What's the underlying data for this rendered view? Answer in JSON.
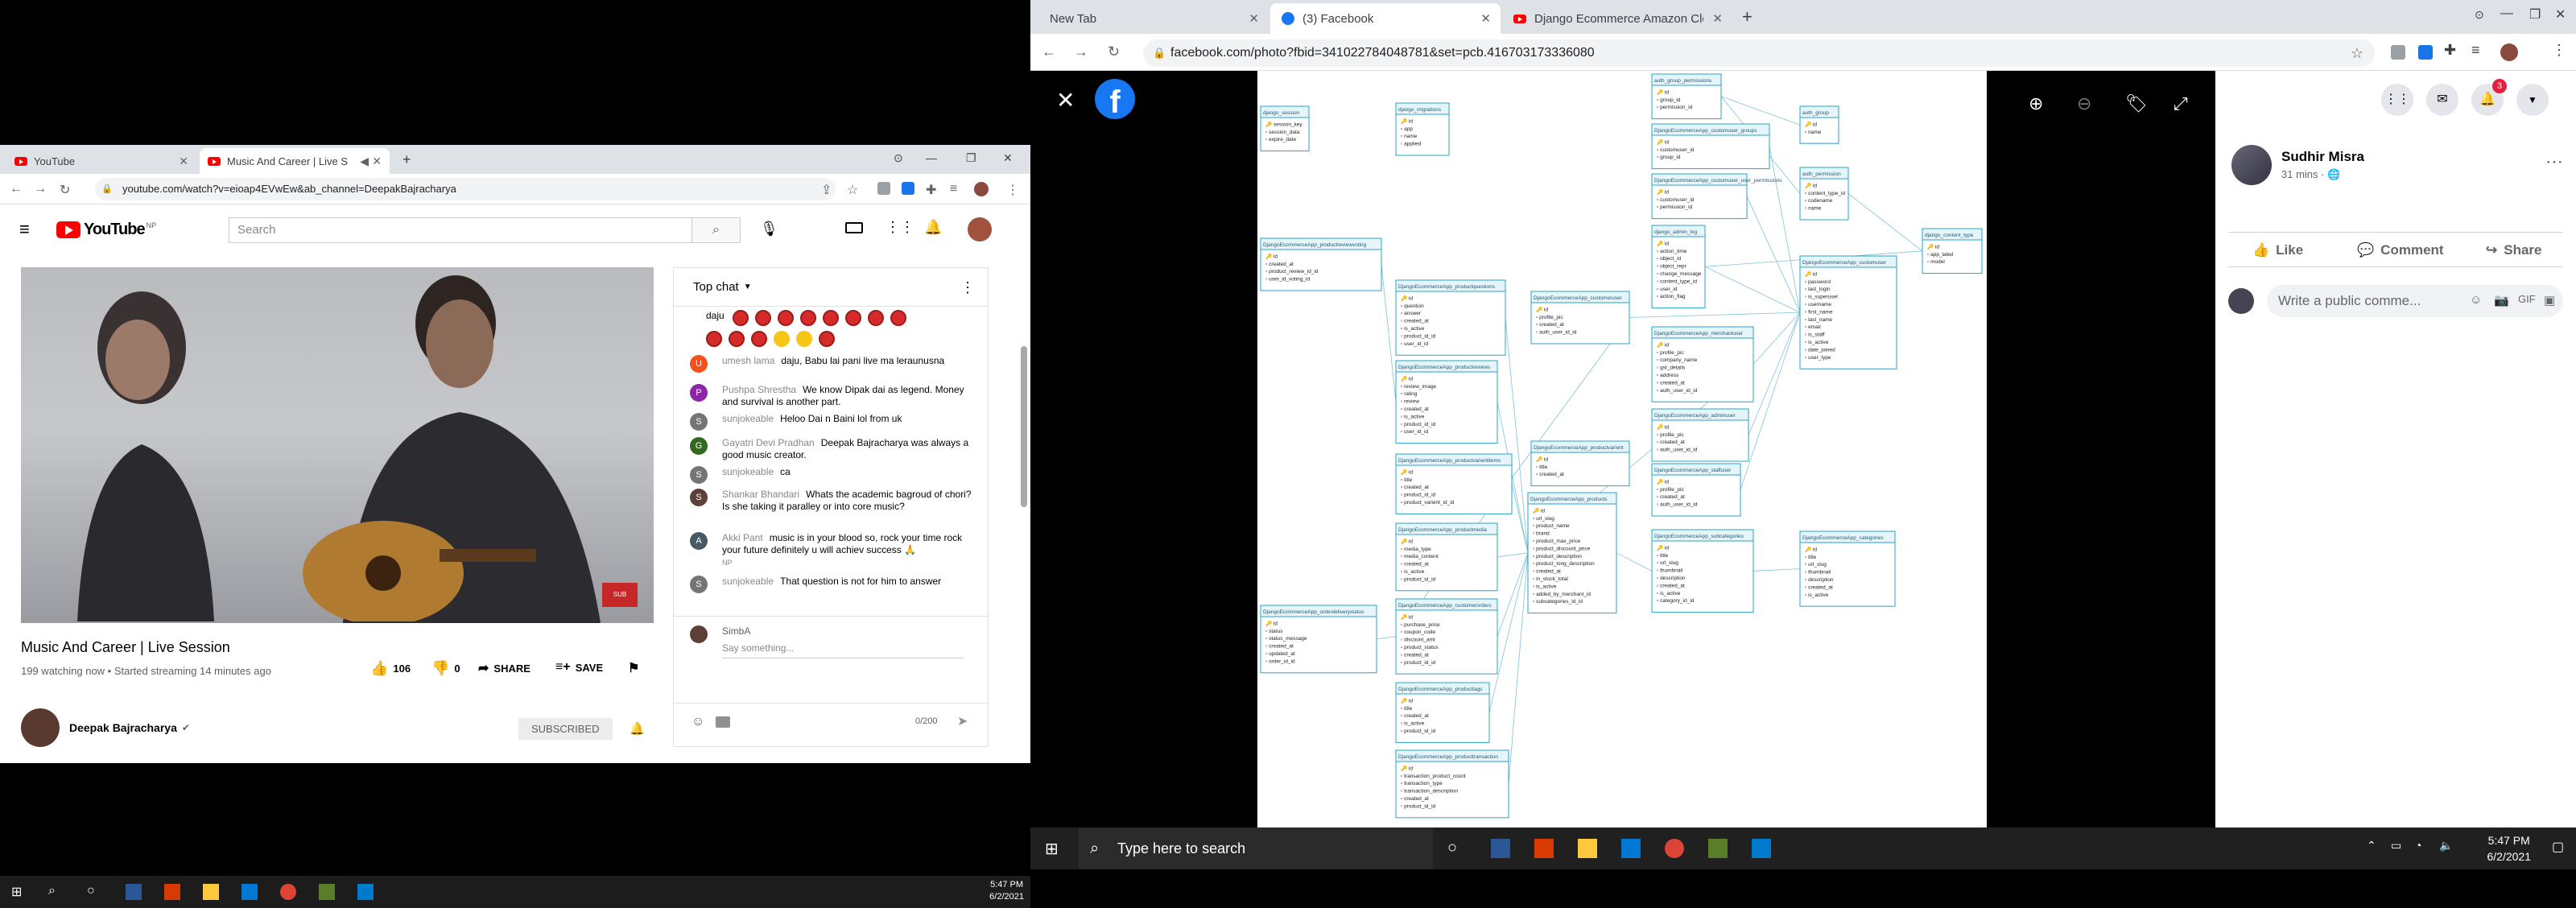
{
  "left_window": {
    "tabs": [
      {
        "title": "YouTube"
      },
      {
        "title": "Music And Career | Live Sess"
      }
    ],
    "url": "youtube.com/watch?v=eioap4EVwEw&ab_channel=DeepakBajracharya",
    "youtube": {
      "logo_text": "YouTube",
      "logo_region": "NP",
      "search_placeholder": "Search"
    },
    "video": {
      "title": "Music And Career | Live Session",
      "meta": "199 watching now • Started streaming 14 minutes ago",
      "likes": "106",
      "dislikes": "0",
      "share_label": "SHARE",
      "save_label": "SAVE",
      "channel_name": "Deepak Bajracharya",
      "subscribe_label": "SUBSCRIBED"
    },
    "chat": {
      "header": "Top chat",
      "first_line": "daju",
      "messages": [
        {
          "author": "umesh lama",
          "text": "daju, Babu lai pani live ma leraunusna",
          "avatar_letter": "U",
          "color": "#f4511e"
        },
        {
          "author": "Pushpa Shrestha",
          "text": "We know Dipak dai as legend. Money and survival is another part.",
          "avatar_letter": "P",
          "color": "#8e24aa"
        },
        {
          "author": "sunjokeable",
          "text": "Heloo Dai n Baini lol from uk",
          "avatar_letter": "S",
          "color": "#757575"
        },
        {
          "author": "Gayatri Devi Pradhan",
          "text": "Deepak Bajracharya was always a good music creator.",
          "avatar_letter": "G",
          "color": "#33691e"
        },
        {
          "author": "sunjokeable",
          "text": "ca",
          "avatar_letter": "S",
          "color": "#757575"
        },
        {
          "author": "Shankar Bhandari",
          "text": "Whats the academic bagroud of chori? Is she taking it paralley or into core music?",
          "avatar_letter": "S",
          "color": "#5d4037"
        },
        {
          "author": "Akki Pant",
          "text": "music is in your blood so, rock your time rock your future definitely u will achiev success 🙏",
          "avatar_letter": "A",
          "color": "#455a64"
        },
        {
          "author": "sunjokeable",
          "text": "That question is not for him to answer",
          "avatar_letter": "S",
          "color": "#757575"
        }
      ],
      "np_tag": "NP",
      "input_user": "SimbA",
      "input_placeholder": "Say something...",
      "char_count": "0/200"
    },
    "taskbar_time": "5:47 PM",
    "taskbar_date": "6/2/2021"
  },
  "right_window": {
    "tabs": [
      {
        "title": "New Tab"
      },
      {
        "title": "(3) Facebook"
      },
      {
        "title": "Django Ecommerce Amazon Clo"
      }
    ],
    "url": "facebook.com/photo?fbid=341022784048781&set=pcb.416703173336080",
    "post": {
      "author": "Sudhir Misra",
      "time": "31 mins · ",
      "like_label": "Like",
      "comment_label": "Comment",
      "share_label": "Share",
      "comment_placeholder": "Write a public comme..."
    },
    "notification_count": "3",
    "taskbar": {
      "search_placeholder": "Type here to search",
      "time": "5:47 PM",
      "date": "6/2/2021"
    }
  },
  "diagram_tables": [
    {
      "name": "django_session",
      "fields": [
        "session_key",
        "session_data",
        "expire_date"
      ]
    },
    {
      "name": "django_migrations",
      "fields": [
        "id",
        "app",
        "name",
        "applied"
      ]
    },
    {
      "name": "auth_group_permissions",
      "fields": [
        "id",
        "group_id",
        "permission_id"
      ]
    },
    {
      "name": "auth_group",
      "fields": [
        "id",
        "name"
      ]
    },
    {
      "name": "DjangoEcommerceApp_customuser_groups",
      "fields": [
        "id",
        "customuser_id",
        "group_id"
      ]
    },
    {
      "name": "auth_permission",
      "fields": [
        "id",
        "content_type_id",
        "codename",
        "name"
      ]
    },
    {
      "name": "DjangoEcommerceApp_customuser_user_permissions",
      "fields": [
        "id",
        "customuser_id",
        "permission_id"
      ]
    },
    {
      "name": "django_content_type",
      "fields": [
        "id",
        "app_label",
        "model"
      ]
    },
    {
      "name": "DjangoEcommerceApp_productreviewvoting",
      "fields": [
        "id",
        "created_at",
        "product_review_id_id",
        "user_id_voting_id"
      ]
    },
    {
      "name": "django_admin_log",
      "fields": [
        "id",
        "action_time",
        "object_id",
        "object_repr",
        "change_message",
        "content_type_id",
        "user_id",
        "action_flag"
      ]
    },
    {
      "name": "DjangoEcommerceApp_customuser",
      "fields": [
        "id",
        "password",
        "last_login",
        "is_superuser",
        "username",
        "first_name",
        "last_name",
        "email",
        "is_staff",
        "is_active",
        "date_joined",
        "user_type"
      ]
    },
    {
      "name": "DjangoEcommerceApp_productquestions",
      "fields": [
        "id",
        "question",
        "answer",
        "created_at",
        "is_active",
        "product_id_id",
        "user_id_id"
      ]
    },
    {
      "name": "DjangoEcommerceApp_customeruser",
      "fields": [
        "id",
        "profile_pic",
        "created_at",
        "auth_user_id_id"
      ]
    },
    {
      "name": "DjangoEcommerceApp_merchantuser",
      "fields": [
        "id",
        "profile_pic",
        "company_name",
        "gst_details",
        "address",
        "created_at",
        "auth_user_id_id"
      ]
    },
    {
      "name": "DjangoEcommerceApp_productreviews",
      "fields": [
        "id",
        "review_image",
        "rating",
        "review",
        "created_at",
        "is_active",
        "product_id_id",
        "user_id_id"
      ]
    },
    {
      "name": "DjangoEcommerceApp_adminuser",
      "fields": [
        "id",
        "profile_pic",
        "created_at",
        "auth_user_id_id"
      ]
    },
    {
      "name": "DjangoEcommerceApp_productvarient",
      "fields": [
        "id",
        "title",
        "created_at"
      ]
    },
    {
      "name": "DjangoEcommerceApp_productvarientitems",
      "fields": [
        "id",
        "title",
        "created_at",
        "product_id_id",
        "product_varient_id_id"
      ]
    },
    {
      "name": "DjangoEcommerceApp_staffuser",
      "fields": [
        "id",
        "profile_pic",
        "created_at",
        "auth_user_id_id"
      ]
    },
    {
      "name": "DjangoEcommerceApp_products",
      "fields": [
        "id",
        "url_slug",
        "product_name",
        "brand",
        "product_max_price",
        "product_discount_price",
        "product_description",
        "product_long_description",
        "created_at",
        "in_stock_total",
        "is_active",
        "added_by_merchant_id",
        "subcategories_id_id"
      ]
    },
    {
      "name": "DjangoEcommerceApp_subcategories",
      "fields": [
        "id",
        "title",
        "url_slug",
        "thumbnail",
        "description",
        "created_at",
        "is_active",
        "category_id_id"
      ]
    },
    {
      "name": "DjangoEcommerceApp_categories",
      "fields": [
        "id",
        "title",
        "url_slug",
        "thumbnail",
        "description",
        "created_at",
        "is_active"
      ]
    },
    {
      "name": "DjangoEcommerceApp_productmedia",
      "fields": [
        "id",
        "media_type",
        "media_content",
        "created_at",
        "is_active",
        "product_id_id"
      ]
    },
    {
      "name": "DjangoEcommerceApp_orderdeliverystatus",
      "fields": [
        "id",
        "status",
        "status_message",
        "created_at",
        "updated_at",
        "order_id_id"
      ]
    },
    {
      "name": "DjangoEcommerceApp_customerorders",
      "fields": [
        "id",
        "purchase_price",
        "coupon_code",
        "discount_amt",
        "product_status",
        "created_at",
        "product_id_id"
      ]
    },
    {
      "name": "DjangoEcommerceApp_producttags",
      "fields": [
        "id",
        "title",
        "created_at",
        "is_active",
        "product_id_id"
      ]
    },
    {
      "name": "DjangoEcommerceApp_producttransaction",
      "fields": [
        "id",
        "transaction_product_count",
        "transaction_type",
        "transaction_description",
        "created_at",
        "product_id_id"
      ]
    }
  ]
}
